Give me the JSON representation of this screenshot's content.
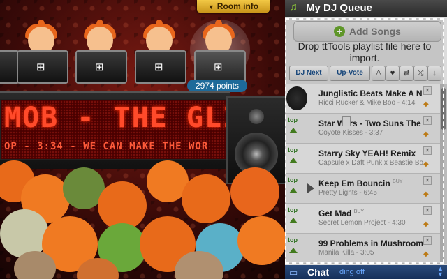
{
  "room": {
    "info_label": "Room info",
    "info_arrow": "▼"
  },
  "points": {
    "label": "2974 points"
  },
  "marquee": {
    "title": "MOB - THE GLIT",
    "subtitle": "OP - 3:34 - WE CAN MAKE THE WOR"
  },
  "queue_panel": {
    "title": "My DJ Queue",
    "add_songs": "Add Songs",
    "drop_message": "Drop ttTools playlist file here to import.",
    "tabs": {
      "dj_next": "DJ Next",
      "up_vote": "Up-Vote"
    },
    "songs": [
      {
        "title": "Junglistic Beats Make A N",
        "meta": "Ricci Rucker & Mike Boo - 4:14",
        "has_top": false,
        "buy": ""
      },
      {
        "title": "Star Wars - Two Suns The",
        "meta": "Coyote Kisses - 3:37",
        "has_top": true,
        "buy": ""
      },
      {
        "title": "Starry Sky YEAH! Remix",
        "meta": "Capsule x Daft Punk x Beastie Bo",
        "has_top": true,
        "buy": ""
      },
      {
        "title": "Keep Em Bouncin",
        "meta": "Pretty Lights - 6:45",
        "has_top": true,
        "buy": "BUY"
      },
      {
        "title": "Get Mad",
        "meta": "Secret Lemon Project - 4:30",
        "has_top": true,
        "buy": "BUY"
      },
      {
        "title": "99 Problems in Mushroom",
        "meta": "Manila Killa - 3:05",
        "has_top": true,
        "buy": ""
      }
    ],
    "top_label": "top"
  },
  "chat": {
    "label": "Chat",
    "ding": "ding off"
  },
  "colors": {
    "accent": "#1e6a9a",
    "marquee_red": "#ff4a2a",
    "room_info_gold": "#f2c845"
  }
}
